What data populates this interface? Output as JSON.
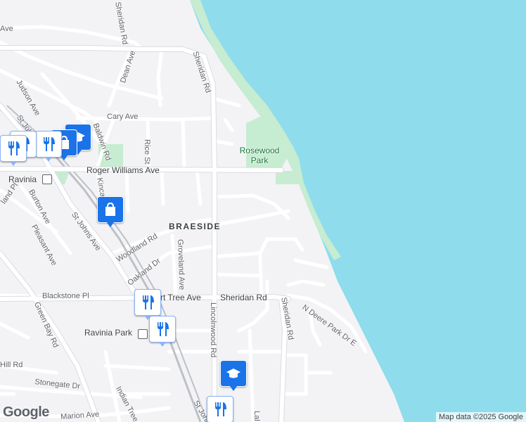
{
  "map": {
    "water_color": "#8fdcec",
    "land_color": "#f3f3f6",
    "park_color": "#c6ecd1",
    "road_color": "#ffffff",
    "major_road_color": "#dadce0"
  },
  "labels": {
    "sheridan_rd_top": "Sheridan Rd",
    "sheridan_rd_upper": "Sheridan Rd",
    "dean_ave": "Dean Ave",
    "judson_ave": "Judson Ave",
    "st_johns_ave_top": "St Johns Ave",
    "cary_ave": "Cary Ave",
    "baldwin_rd": "Baldwin Rd",
    "rice_st": "Rice St",
    "rosewood_park": "Rosewood Park",
    "roger_williams_ave": "Roger Williams Ave",
    "ravinia": "Ravinia",
    "burton_ave": "Burton Ave",
    "kincaid": "Kinca",
    "st_johns_ave_mid": "St Johns Ave",
    "pleasant_ave": "Pleasant Ave",
    "woodland_rd": "Woodland Rd",
    "braeside": "BRAESIDE",
    "groveland_ave": "Groveland Ave",
    "oakland_dr": "Oakland Dr",
    "blackstone_pl": "Blackstone Pl",
    "hart_tree_ave": "rt Tree Ave",
    "sheridan_rd_mid": "Sheridan Rd",
    "sheridan_rd_vert": "Sheridan Rd",
    "lincolnwood_rd": "Lincolnwood Rd",
    "n_deere_park_dr_e": "N Deere Park Dr E",
    "green_bay_rd": "Green Bay Rd",
    "ravinia_park": "Ravinia Park",
    "hill_rd": "Hill Rd",
    "stonegate_dr": "Stonegate Dr",
    "indian_tree": "Indian Tree",
    "marion_ave": "Marion Ave",
    "st_johns_bottom": "St John",
    "lake_bottom": "Lal",
    "ave_top_left": "Ave",
    "highland_pl": "land Pl"
  },
  "pins": [
    {
      "name": "restaurant-pin-1",
      "icon": "fork-knife-icon"
    },
    {
      "name": "restaurant-pin-2",
      "icon": "fork-knife-icon"
    },
    {
      "name": "restaurant-pin-3",
      "icon": "fork-knife-icon"
    },
    {
      "name": "shopping-pin-1",
      "icon": "shopping-bag-icon"
    },
    {
      "name": "school-pin-1",
      "icon": "graduation-cap-icon"
    },
    {
      "name": "shopping-pin-2",
      "icon": "shopping-bag-icon"
    },
    {
      "name": "restaurant-pin-4",
      "icon": "fork-knife-icon"
    },
    {
      "name": "restaurant-pin-5",
      "icon": "fork-knife-icon"
    },
    {
      "name": "school-pin-2",
      "icon": "graduation-cap-icon"
    },
    {
      "name": "restaurant-pin-6",
      "icon": "fork-knife-icon"
    }
  ],
  "footer": {
    "logo": "Google",
    "attribution": "Map data ©2025 Google"
  }
}
